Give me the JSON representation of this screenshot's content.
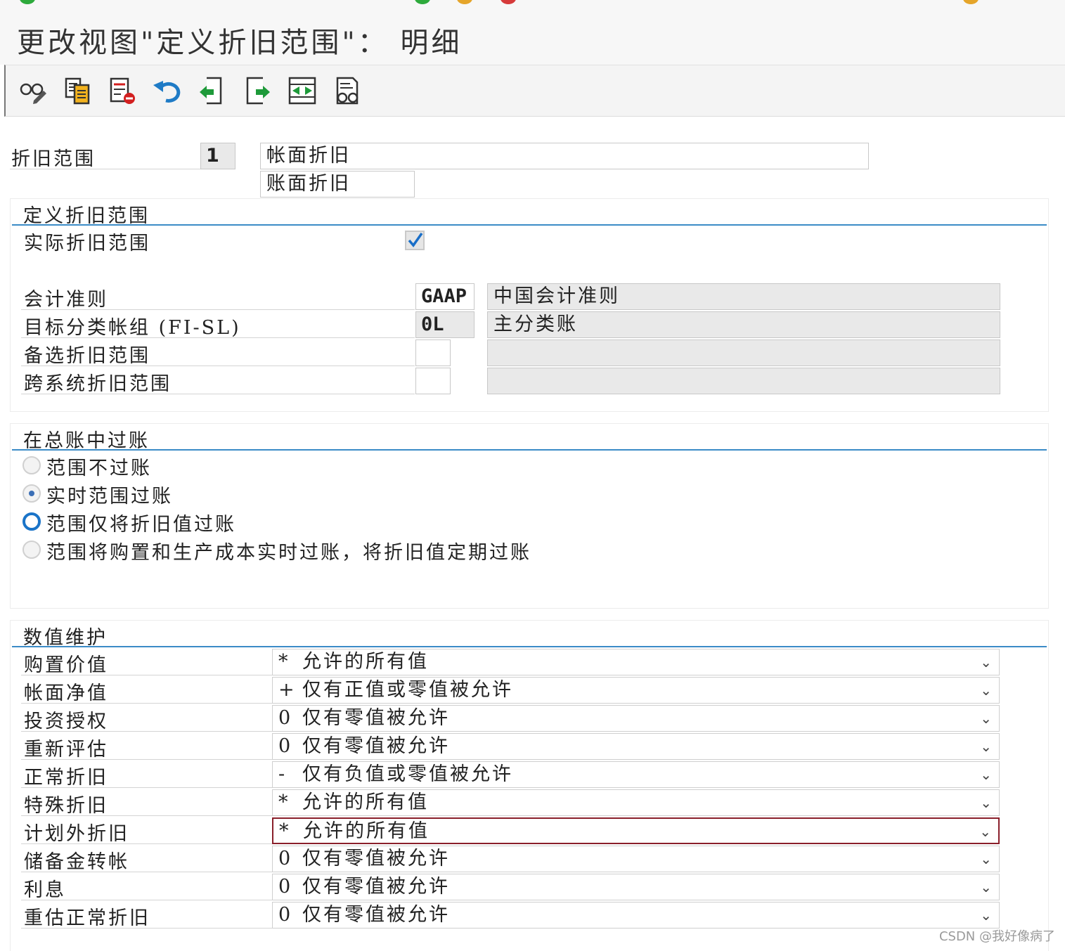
{
  "window": {
    "title": "更改视图\"定义折旧范围\"： 明细"
  },
  "toolbar": {
    "buttons": [
      {
        "name": "display-change-icon"
      },
      {
        "name": "copy-icon"
      },
      {
        "name": "delete-icon"
      },
      {
        "name": "undo-icon"
      },
      {
        "name": "previous-entry-icon"
      },
      {
        "name": "next-entry-icon"
      },
      {
        "name": "select-block-icon"
      },
      {
        "name": "print-icon"
      }
    ]
  },
  "header": {
    "area_label": "折旧范围",
    "area_value": "1",
    "description_long": "帐面折旧",
    "description_short": "账面折旧"
  },
  "define_group": {
    "title": "定义折旧范围",
    "real_area_label": "实际折旧范围",
    "real_area_checked": true,
    "rows": [
      {
        "label": "会计准则",
        "code": "GAAP",
        "text": "中国会计准则"
      },
      {
        "label": "目标分类帐组 (FI-SL)",
        "code": "0L",
        "text": "主分类账"
      },
      {
        "label": "备选折旧范围",
        "code": "",
        "text": ""
      },
      {
        "label": "跨系统折旧范围",
        "code": "",
        "text": ""
      }
    ]
  },
  "posting_group": {
    "title": "在总账中过账",
    "options": [
      {
        "label": "范围不过账",
        "state": "unselected"
      },
      {
        "label": "实时范围过账",
        "state": "selected"
      },
      {
        "label": "范围仅将折旧值过账",
        "state": "focused"
      },
      {
        "label": "范围将购置和生产成本实时过账，将折旧值定期过账",
        "state": "unselected"
      }
    ]
  },
  "values_group": {
    "title": "数值维护",
    "rows": [
      {
        "label": "购置价值",
        "code": "*",
        "text": "允许的所有值"
      },
      {
        "label": "帐面净值",
        "code": "+",
        "text": "仅有正值或零值被允许"
      },
      {
        "label": "投资授权",
        "code": "0",
        "text": "仅有零值被允许"
      },
      {
        "label": "重新评估",
        "code": "0",
        "text": "仅有零值被允许"
      },
      {
        "label": "正常折旧",
        "code": "-",
        "text": "仅有负值或零值被允许"
      },
      {
        "label": "特殊折旧",
        "code": "*",
        "text": "允许的所有值"
      },
      {
        "label": "计划外折旧",
        "code": "*",
        "text": "允许的所有值"
      },
      {
        "label": "储备金转帐",
        "code": "0",
        "text": "仅有零值被允许"
      },
      {
        "label": "利息",
        "code": "0",
        "text": "仅有零值被允许"
      },
      {
        "label": "重估正常折旧",
        "code": "0",
        "text": "仅有零值被允许"
      }
    ],
    "focused_row_index": 6
  },
  "watermark": "CSDN @我好像病了",
  "colors": {
    "group_line": "#3b8bc7",
    "focus_radio": "#1a74c8",
    "focus_dropdown": "#8a1f2b"
  }
}
